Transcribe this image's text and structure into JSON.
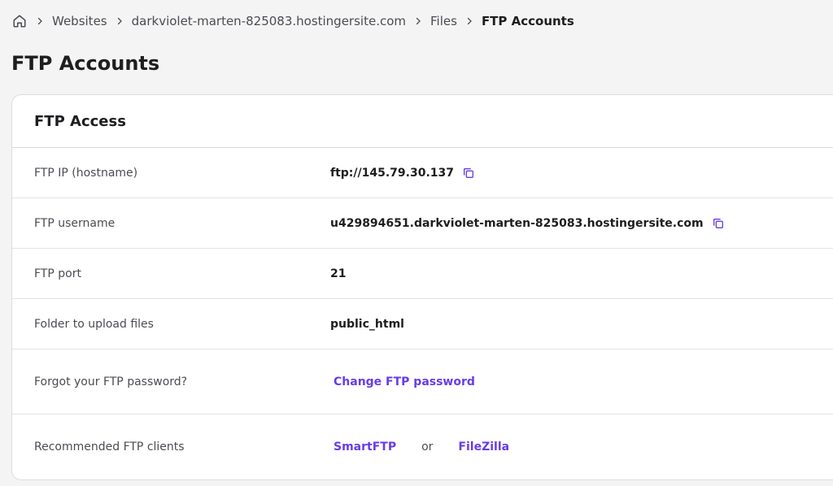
{
  "breadcrumb": {
    "items": [
      "Websites",
      "darkviolet-marten-825083.hostingersite.com",
      "Files"
    ],
    "current": "FTP Accounts"
  },
  "page": {
    "title": "FTP Accounts"
  },
  "ftp_access": {
    "title": "FTP Access",
    "rows": [
      {
        "label": "FTP IP (hostname)",
        "value": "ftp://145.79.30.137"
      },
      {
        "label": "FTP username",
        "value": "u429894651.darkviolet-marten-825083.hostingersite.com"
      },
      {
        "label": "FTP port",
        "value": "21"
      },
      {
        "label": "Folder to upload files",
        "value": "public_html"
      },
      {
        "label": "Forgot your FTP password?",
        "link": "Change FTP password"
      },
      {
        "label": "Recommended FTP clients",
        "link1": "SmartFTP",
        "separator": "or",
        "link2": "FileZilla"
      }
    ]
  },
  "icons": {
    "home": "home-icon",
    "separator": "chevron-right-icon",
    "copy": "copy-icon"
  },
  "colors": {
    "accent": "#673de6",
    "text": "#1d1e20",
    "muted": "#4b4c52",
    "background": "#f4f4f4"
  }
}
